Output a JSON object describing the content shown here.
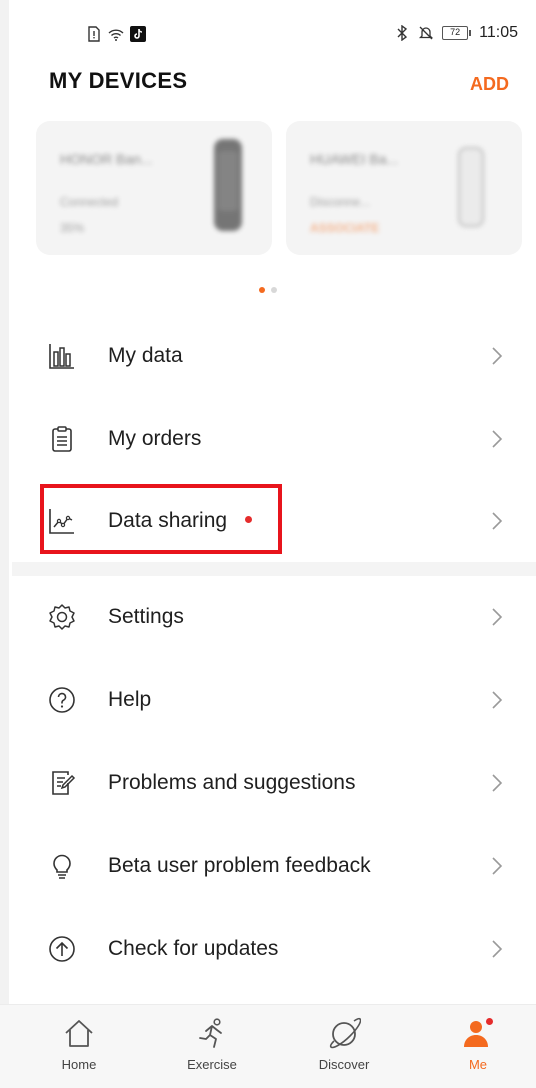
{
  "status_bar": {
    "time": "11:05",
    "battery": "72"
  },
  "header": {
    "title": "MY DEVICES",
    "add_label": "ADD"
  },
  "devices": [
    {
      "name": "HONOR Ban...",
      "status": "Connected",
      "battery": "35%"
    },
    {
      "name": "HUAWEI Ba...",
      "status": "Disconne...",
      "action": "ASSOCIATE"
    }
  ],
  "menu": [
    {
      "label": "My data",
      "icon": "bar-chart-icon"
    },
    {
      "label": "My orders",
      "icon": "clipboard-icon"
    },
    {
      "label": "Data sharing",
      "icon": "line-chart-icon",
      "badge": true
    },
    {
      "label": "Settings",
      "icon": "gear-icon"
    },
    {
      "label": "Help",
      "icon": "question-icon"
    },
    {
      "label": "Problems and suggestions",
      "icon": "edit-note-icon"
    },
    {
      "label": "Beta user problem feedback",
      "icon": "lightbulb-icon"
    },
    {
      "label": "Check for updates",
      "icon": "upload-arrow-icon"
    }
  ],
  "bottom_nav": [
    {
      "label": "Home",
      "icon": "home-icon"
    },
    {
      "label": "Exercise",
      "icon": "running-icon"
    },
    {
      "label": "Discover",
      "icon": "planet-icon"
    },
    {
      "label": "Me",
      "icon": "person-icon",
      "active": true
    }
  ],
  "colors": {
    "accent": "#f46a1f",
    "badge": "#e52c2c",
    "highlight": "#e8141c"
  }
}
